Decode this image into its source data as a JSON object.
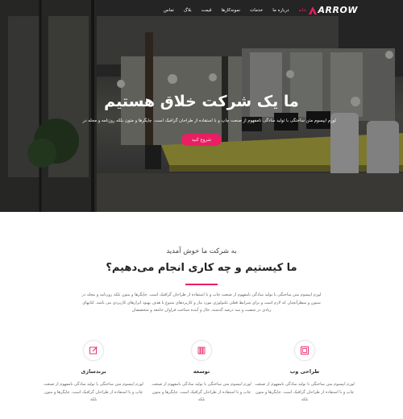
{
  "brand": {
    "logo_text": "ARROW",
    "accent_color": "#e91e63"
  },
  "nav": [
    {
      "label": "خانه",
      "active": true
    },
    {
      "label": "درباره ما",
      "active": false
    },
    {
      "label": "خدمات",
      "active": false
    },
    {
      "label": "نمونه‌کارها",
      "active": false
    },
    {
      "label": "قیمت",
      "active": false
    },
    {
      "label": "بلاگ",
      "active": false
    },
    {
      "label": "تماس",
      "active": false
    }
  ],
  "hero": {
    "title": "ما یک شرکت خلاق هستیم",
    "subtitle": "لورم ایپسوم متن ساختگی با تولید سادگی نامفهوم از صنعت چاپ و با استفاده از طراحان گرافیک است. چاپگرها و متون بلکه روزنامه و مجله در",
    "button_label": "شروع کنید"
  },
  "about": {
    "welcome": "به شرکت ما خوش آمدید",
    "title": "ما کیستیم و چه کاری انجام می‌دهیم؟",
    "text": "لورم ایپسوم متن ساختگی با تولید سادگی نامفهوم از صنعت چاپ و با استفاده از طراحان گرافیک است. چاپگرها و متون بلکه روزنامه و مجله در ستون و سطرآنچنان که لازم است و برای شرایط فعلی تکنولوژی مورد نیاز و کاربردهای متنوع با هدف بهبود ابزارهای کاربردی می باشد. کتابهای زیادی در شصت و سه درصد گذشته، حال و آینده شناخت فراوان جامعه و متخصصان"
  },
  "services": [
    {
      "icon": "web-design-icon",
      "title": "طراحی وب",
      "text": "لورم ایپسوم متن ساختگی با تولید سادگی نامفهوم از صنعت چاپ و با استفاده از طراحان گرافیک است. چاپگرها و متون بلکه"
    },
    {
      "icon": "development-icon",
      "title": "توسعه",
      "text": "لورم ایپسوم متن ساختگی با تولید سادگی نامفهوم از صنعت چاپ و با استفاده از طراحان گرافیک است. چاپگرها و متون بلکه"
    },
    {
      "icon": "branding-icon",
      "title": "برندسازی",
      "text": "لورم ایپسوم متن ساختگی با تولید سادگی نامفهوم از صنعت چاپ و با استفاده از طراحان گرافیک است. چاپگرها و متون بلکه"
    }
  ]
}
